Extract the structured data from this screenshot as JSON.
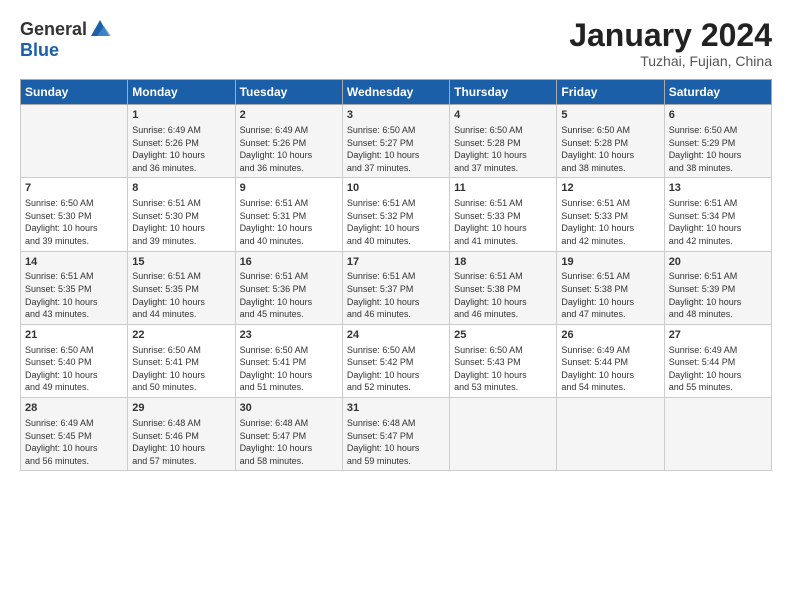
{
  "logo": {
    "general": "General",
    "blue": "Blue"
  },
  "header": {
    "title": "January 2024",
    "subtitle": "Tuzhai, Fujian, China"
  },
  "weekdays": [
    "Sunday",
    "Monday",
    "Tuesday",
    "Wednesday",
    "Thursday",
    "Friday",
    "Saturday"
  ],
  "weeks": [
    [
      {
        "day": "",
        "info": ""
      },
      {
        "day": "1",
        "info": "Sunrise: 6:49 AM\nSunset: 5:26 PM\nDaylight: 10 hours\nand 36 minutes."
      },
      {
        "day": "2",
        "info": "Sunrise: 6:49 AM\nSunset: 5:26 PM\nDaylight: 10 hours\nand 36 minutes."
      },
      {
        "day": "3",
        "info": "Sunrise: 6:50 AM\nSunset: 5:27 PM\nDaylight: 10 hours\nand 37 minutes."
      },
      {
        "day": "4",
        "info": "Sunrise: 6:50 AM\nSunset: 5:28 PM\nDaylight: 10 hours\nand 37 minutes."
      },
      {
        "day": "5",
        "info": "Sunrise: 6:50 AM\nSunset: 5:28 PM\nDaylight: 10 hours\nand 38 minutes."
      },
      {
        "day": "6",
        "info": "Sunrise: 6:50 AM\nSunset: 5:29 PM\nDaylight: 10 hours\nand 38 minutes."
      }
    ],
    [
      {
        "day": "7",
        "info": "Sunrise: 6:50 AM\nSunset: 5:30 PM\nDaylight: 10 hours\nand 39 minutes."
      },
      {
        "day": "8",
        "info": "Sunrise: 6:51 AM\nSunset: 5:30 PM\nDaylight: 10 hours\nand 39 minutes."
      },
      {
        "day": "9",
        "info": "Sunrise: 6:51 AM\nSunset: 5:31 PM\nDaylight: 10 hours\nand 40 minutes."
      },
      {
        "day": "10",
        "info": "Sunrise: 6:51 AM\nSunset: 5:32 PM\nDaylight: 10 hours\nand 40 minutes."
      },
      {
        "day": "11",
        "info": "Sunrise: 6:51 AM\nSunset: 5:33 PM\nDaylight: 10 hours\nand 41 minutes."
      },
      {
        "day": "12",
        "info": "Sunrise: 6:51 AM\nSunset: 5:33 PM\nDaylight: 10 hours\nand 42 minutes."
      },
      {
        "day": "13",
        "info": "Sunrise: 6:51 AM\nSunset: 5:34 PM\nDaylight: 10 hours\nand 42 minutes."
      }
    ],
    [
      {
        "day": "14",
        "info": "Sunrise: 6:51 AM\nSunset: 5:35 PM\nDaylight: 10 hours\nand 43 minutes."
      },
      {
        "day": "15",
        "info": "Sunrise: 6:51 AM\nSunset: 5:35 PM\nDaylight: 10 hours\nand 44 minutes."
      },
      {
        "day": "16",
        "info": "Sunrise: 6:51 AM\nSunset: 5:36 PM\nDaylight: 10 hours\nand 45 minutes."
      },
      {
        "day": "17",
        "info": "Sunrise: 6:51 AM\nSunset: 5:37 PM\nDaylight: 10 hours\nand 46 minutes."
      },
      {
        "day": "18",
        "info": "Sunrise: 6:51 AM\nSunset: 5:38 PM\nDaylight: 10 hours\nand 46 minutes."
      },
      {
        "day": "19",
        "info": "Sunrise: 6:51 AM\nSunset: 5:38 PM\nDaylight: 10 hours\nand 47 minutes."
      },
      {
        "day": "20",
        "info": "Sunrise: 6:51 AM\nSunset: 5:39 PM\nDaylight: 10 hours\nand 48 minutes."
      }
    ],
    [
      {
        "day": "21",
        "info": "Sunrise: 6:50 AM\nSunset: 5:40 PM\nDaylight: 10 hours\nand 49 minutes."
      },
      {
        "day": "22",
        "info": "Sunrise: 6:50 AM\nSunset: 5:41 PM\nDaylight: 10 hours\nand 50 minutes."
      },
      {
        "day": "23",
        "info": "Sunrise: 6:50 AM\nSunset: 5:41 PM\nDaylight: 10 hours\nand 51 minutes."
      },
      {
        "day": "24",
        "info": "Sunrise: 6:50 AM\nSunset: 5:42 PM\nDaylight: 10 hours\nand 52 minutes."
      },
      {
        "day": "25",
        "info": "Sunrise: 6:50 AM\nSunset: 5:43 PM\nDaylight: 10 hours\nand 53 minutes."
      },
      {
        "day": "26",
        "info": "Sunrise: 6:49 AM\nSunset: 5:44 PM\nDaylight: 10 hours\nand 54 minutes."
      },
      {
        "day": "27",
        "info": "Sunrise: 6:49 AM\nSunset: 5:44 PM\nDaylight: 10 hours\nand 55 minutes."
      }
    ],
    [
      {
        "day": "28",
        "info": "Sunrise: 6:49 AM\nSunset: 5:45 PM\nDaylight: 10 hours\nand 56 minutes."
      },
      {
        "day": "29",
        "info": "Sunrise: 6:48 AM\nSunset: 5:46 PM\nDaylight: 10 hours\nand 57 minutes."
      },
      {
        "day": "30",
        "info": "Sunrise: 6:48 AM\nSunset: 5:47 PM\nDaylight: 10 hours\nand 58 minutes."
      },
      {
        "day": "31",
        "info": "Sunrise: 6:48 AM\nSunset: 5:47 PM\nDaylight: 10 hours\nand 59 minutes."
      },
      {
        "day": "",
        "info": ""
      },
      {
        "day": "",
        "info": ""
      },
      {
        "day": "",
        "info": ""
      }
    ]
  ]
}
